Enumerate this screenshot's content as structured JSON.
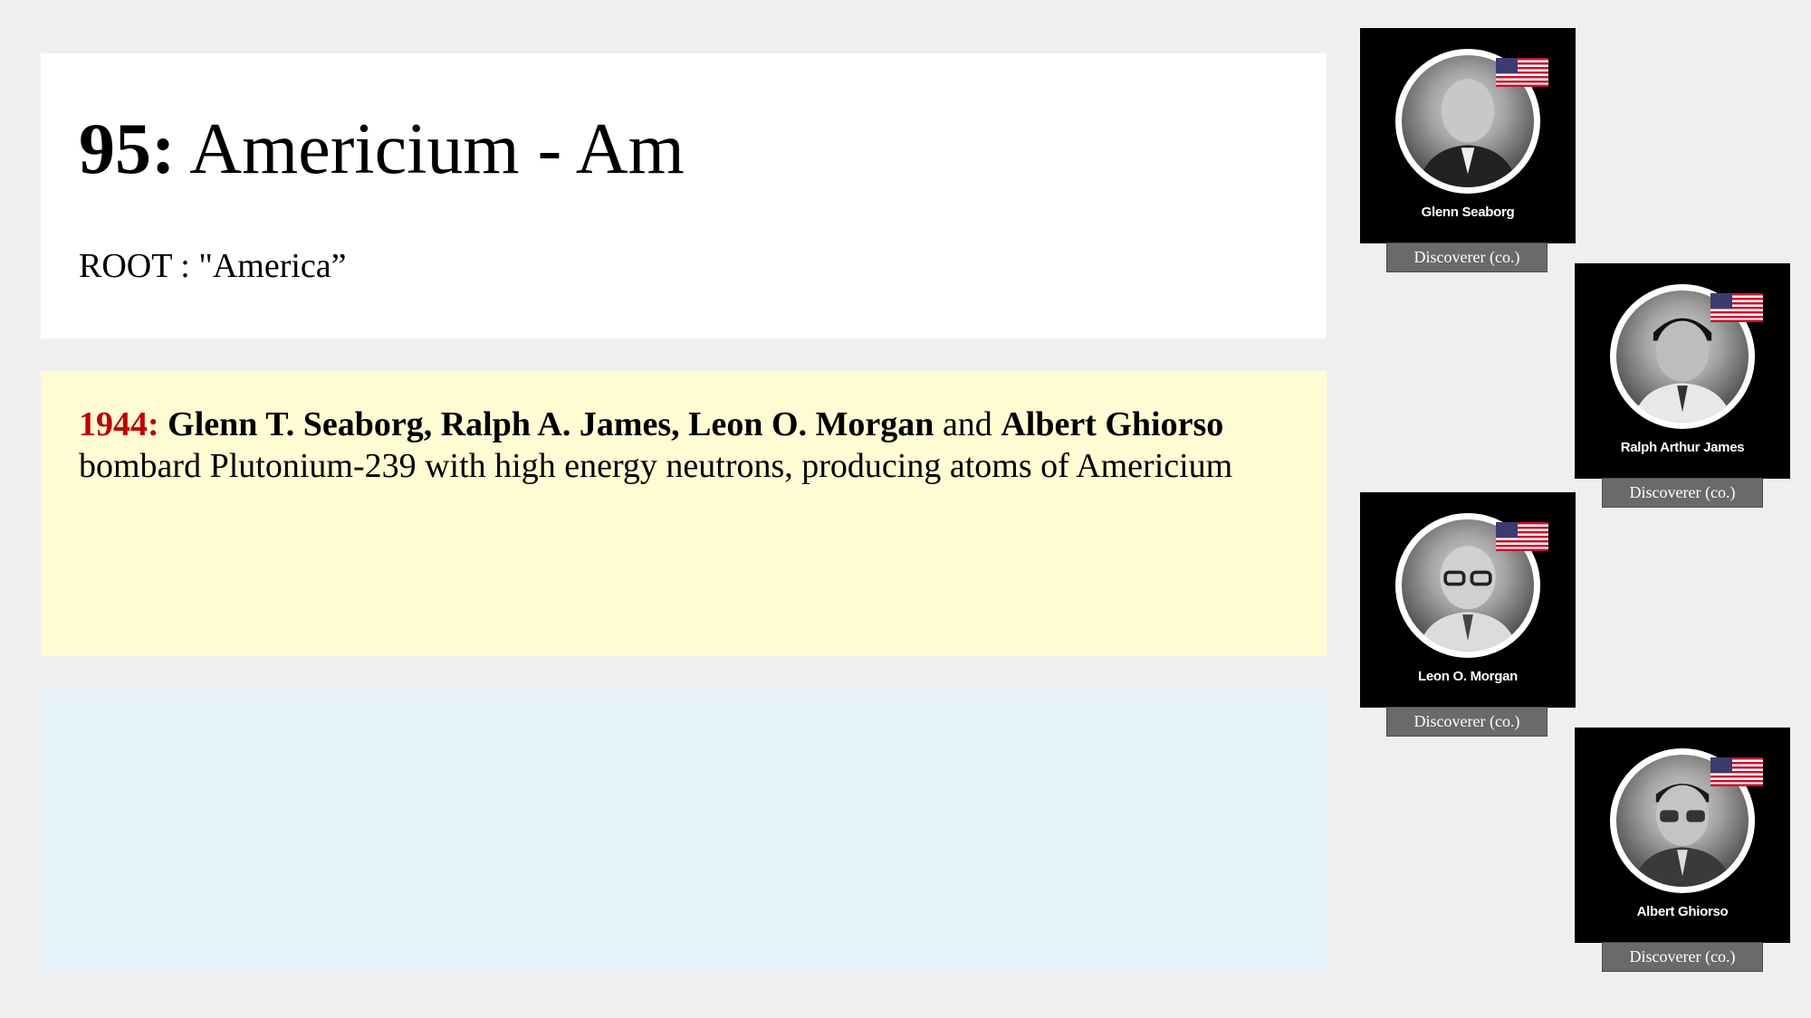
{
  "header": {
    "number": "95:",
    "element_name": "Americium - Am",
    "root_text": "ROOT : \"America”"
  },
  "event": {
    "year": "1944:",
    "name1": "Glenn T. Seaborg, Ralph A. James, Leon O. Morgan",
    "conjunction": " and ",
    "name2": "Albert Ghiorso",
    "description": "bombard Plutonium-239 with high energy neutrons, producing atoms of Americium"
  },
  "discoverers": [
    {
      "name": "Glenn Seaborg",
      "role": "Discoverer (co.)",
      "flag": "usa-flag-icon"
    },
    {
      "name": "Ralph Arthur James",
      "role": "Discoverer (co.)",
      "flag": "usa-flag-icon"
    },
    {
      "name": "Leon O. Morgan",
      "role": "Discoverer (co.)",
      "flag": "usa-flag-icon"
    },
    {
      "name": "Albert Ghiorso",
      "role": "Discoverer (co.)",
      "flag": "usa-flag-icon"
    }
  ],
  "colors": {
    "year": "#c00000",
    "event_panel": "#fffcd3",
    "blank_panel": "#e6f3fb",
    "role_badge": "#6a6a6a"
  }
}
